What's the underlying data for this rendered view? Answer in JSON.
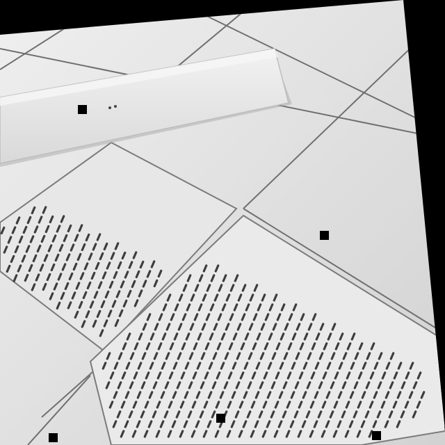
{
  "photo": {
    "subject": "",
    "colors": {
      "background": "#000000",
      "floor_tile": "#e4e4e4",
      "floor_tile_shade": "#d6d6d6",
      "grout_line": "#6f6f6f",
      "perforated_panel": "#e9e9e9",
      "perforation_slot": "#3d3d3d",
      "board": "#ececec",
      "board_edge": "#bdbdbd",
      "marker": "#000000"
    }
  }
}
